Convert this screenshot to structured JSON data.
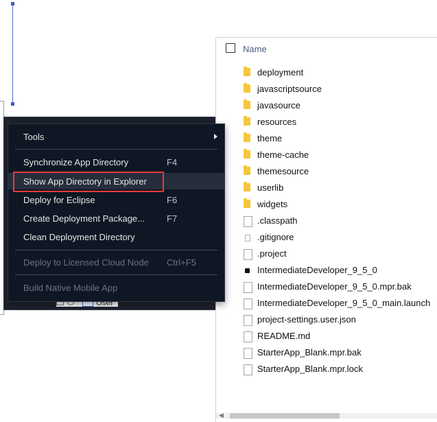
{
  "explorer": {
    "header_name": "Name",
    "items": [
      {
        "label": "deployment",
        "icon": "folder-icon"
      },
      {
        "label": "javascriptsource",
        "icon": "folder-icon"
      },
      {
        "label": "javasource",
        "icon": "folder-icon"
      },
      {
        "label": "resources",
        "icon": "folder-icon"
      },
      {
        "label": "theme",
        "icon": "folder-icon"
      },
      {
        "label": "theme-cache",
        "icon": "folder-icon"
      },
      {
        "label": "themesource",
        "icon": "folder-icon"
      },
      {
        "label": "userlib",
        "icon": "folder-icon"
      },
      {
        "label": "widgets",
        "icon": "folder-icon"
      },
      {
        "label": ".classpath",
        "icon": "file-icon"
      },
      {
        "label": ".gitignore",
        "icon": "file-icon"
      },
      {
        "label": ".project",
        "icon": "file-icon"
      },
      {
        "label": "IntermediateDeveloper_9_5_0",
        "icon": "mendix-project-icon"
      },
      {
        "label": "IntermediateDeveloper_9_5_0.mpr.bak",
        "icon": "file-icon"
      },
      {
        "label": "IntermediateDeveloper_9_5_0_main.launch",
        "icon": "file-icon"
      },
      {
        "label": "project-settings.user.json",
        "icon": "file-icon"
      },
      {
        "label": "README.md",
        "icon": "file-icon"
      },
      {
        "label": "StarterApp_Blank.mpr.bak",
        "icon": "file-icon"
      },
      {
        "label": "StarterApp_Blank.mpr.lock",
        "icon": "file-icon"
      }
    ]
  },
  "menu": {
    "tools_label": "Tools",
    "items": [
      {
        "label": "Synchronize App Directory",
        "shortcut": "F4",
        "enabled": true
      },
      {
        "label": "Show App Directory in Explorer",
        "shortcut": "",
        "enabled": true
      },
      {
        "label": "Deploy for Eclipse",
        "shortcut": "F6",
        "enabled": true
      },
      {
        "label": "Create Deployment Package...",
        "shortcut": "F7",
        "enabled": true
      },
      {
        "label": "Clean Deployment Directory",
        "shortcut": "",
        "enabled": true
      },
      {
        "label": "Deploy to Licensed Cloud Node",
        "shortcut": "Ctrl+F5",
        "enabled": false
      },
      {
        "label": "Build Native Mobile App",
        "shortcut": "",
        "enabled": false
      }
    ]
  },
  "background": {
    "tree_row_label": "User",
    "peek_e": "e",
    "peek_w": "w"
  },
  "colors": {
    "menu_bg": "#0f1724",
    "highlight_border": "#e83b3b",
    "folder": "#f5c638",
    "header_text": "#4a5a80"
  }
}
